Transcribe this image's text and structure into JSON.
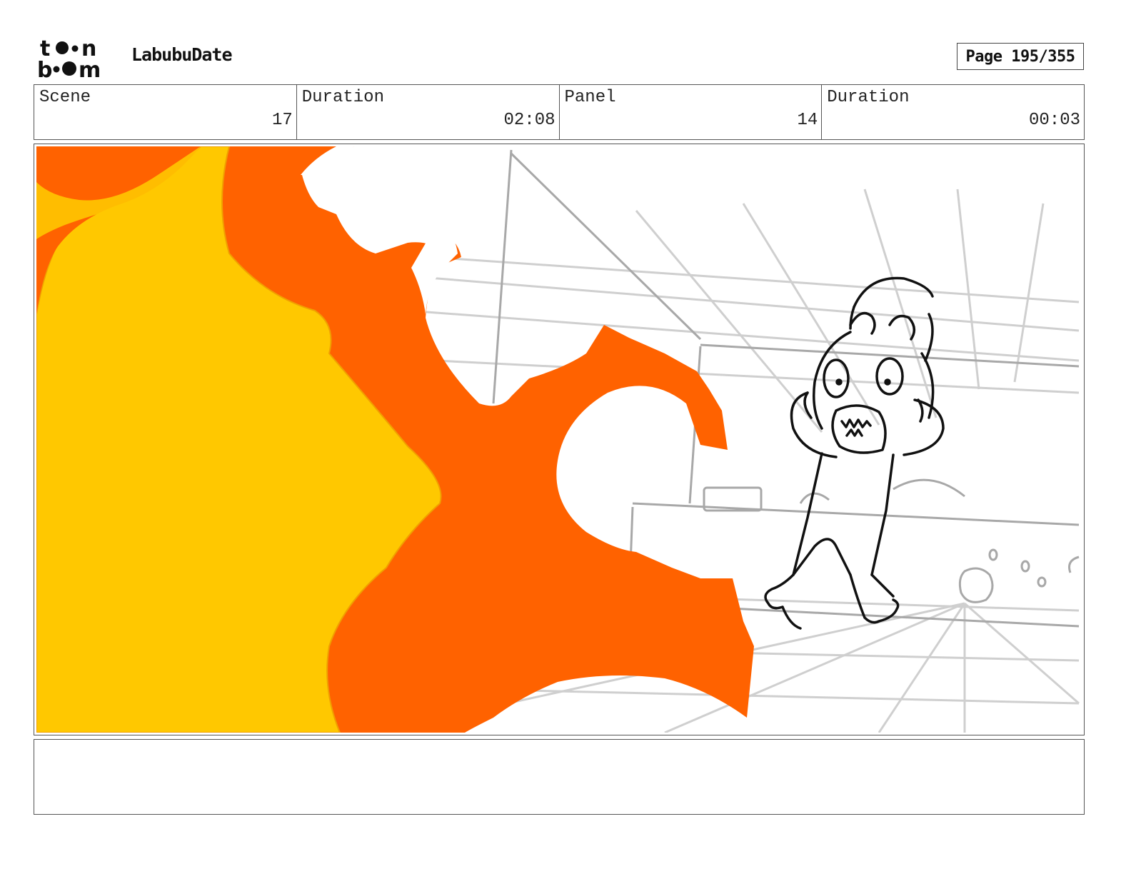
{
  "header": {
    "logo_text": "toonboom",
    "project_title": "LabubuDate",
    "page_label": "Page 195/355"
  },
  "info": [
    {
      "label": "Scene",
      "value": "17"
    },
    {
      "label": "Duration",
      "value": "02:08"
    },
    {
      "label": "Panel",
      "value": "14"
    },
    {
      "label": "Duration",
      "value": "00:03"
    }
  ],
  "panel": {
    "description_icon": "storyboard-drawing",
    "colors": {
      "fire_outer": "#ff6200",
      "fire_inner": "#ffc800",
      "sketch_line": "#111111",
      "background_line": "#c8c8c8"
    }
  },
  "notes": {
    "text": ""
  }
}
